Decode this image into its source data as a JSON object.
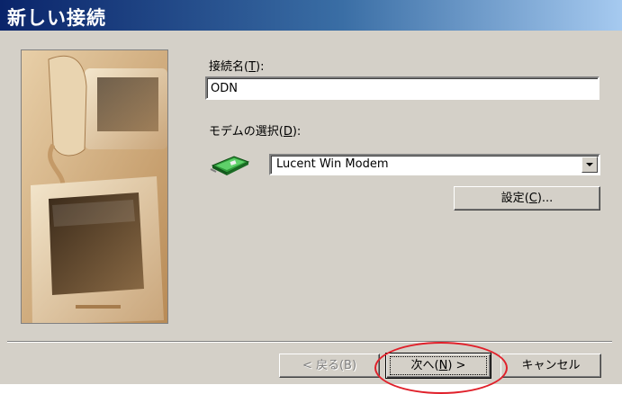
{
  "window": {
    "title": "新しい接続"
  },
  "form": {
    "connection_name_label": "接続名",
    "connection_name_mnemonic": "(T)",
    "connection_name_mnemonic_char": "T",
    "connection_name_value": "ODN",
    "modem_select_label": "モデムの選択",
    "modem_select_mnemonic_open": "(",
    "modem_select_mnemonic_char": "D",
    "modem_select_mnemonic_close": "):",
    "modem_selected": "Lucent Win Modem",
    "modem_icon": "modem-icon",
    "settings_button_label": "設定",
    "settings_button_mnemonic_open": "(",
    "settings_button_mnemonic_char": "C",
    "settings_button_mnemonic_close": ")..."
  },
  "buttons": {
    "back_label": "< 戻る(B)",
    "next_label_pre": "次へ(",
    "next_mnemonic_char": "N",
    "next_label_post": ") >",
    "cancel_label": "キャンセル"
  },
  "annotation": {
    "highlight_color": "#e0202a"
  },
  "colors": {
    "title_gradient_start": "#0a246a",
    "title_gradient_end": "#a6caf0",
    "dialog_background": "#d4d0c8"
  }
}
